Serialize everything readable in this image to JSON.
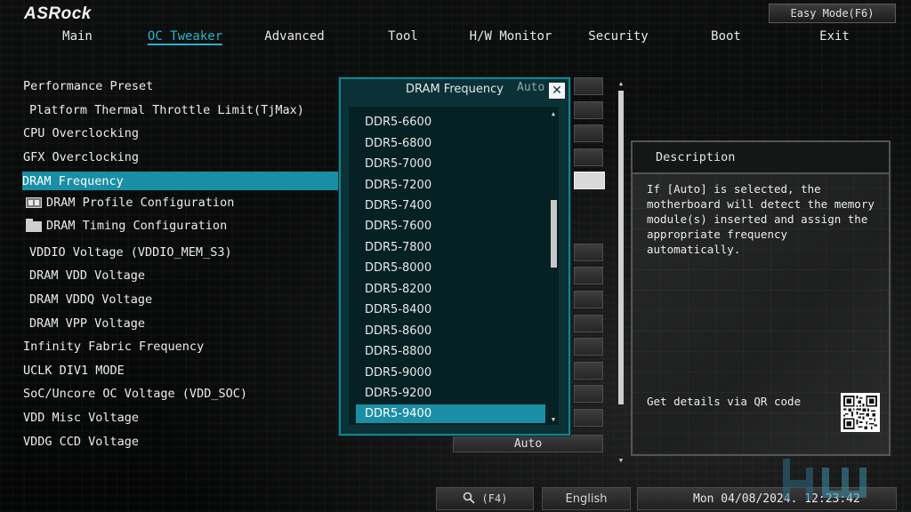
{
  "brand": {
    "logo": "ASRock"
  },
  "header": {
    "easy_mode_label": "Easy Mode(F6)",
    "tabs": [
      {
        "label": "Main",
        "active": false
      },
      {
        "label": "OC Tweaker",
        "active": true
      },
      {
        "label": "Advanced",
        "active": false
      },
      {
        "label": "Tool",
        "active": false
      },
      {
        "label": "H/W Monitor",
        "active": false
      },
      {
        "label": "Security",
        "active": false
      },
      {
        "label": "Boot",
        "active": false
      },
      {
        "label": "Exit",
        "active": false
      }
    ]
  },
  "menu": {
    "items": [
      {
        "label": "Performance Preset"
      },
      {
        "label": "Platform Thermal Throttle Limit(TjMax)"
      },
      {
        "label": "CPU Overclocking"
      },
      {
        "label": "GFX Overclocking"
      },
      {
        "label": "DRAM Frequency",
        "selected": true
      },
      {
        "label": "DRAM Profile Configuration",
        "icon": "profile-icon"
      },
      {
        "label": "DRAM Timing Configuration",
        "icon": "folder-icon"
      },
      {
        "label": "VDDIO Voltage (VDDIO_MEM_S3)"
      },
      {
        "label": "DRAM VDD Voltage"
      },
      {
        "label": "DRAM VDDQ Voltage"
      },
      {
        "label": "DRAM VPP Voltage"
      },
      {
        "label": "Infinity Fabric Frequency"
      },
      {
        "label": "UCLK DIV1 MODE"
      },
      {
        "label": "SoC/Uncore OC Voltage (VDD_SOC)"
      },
      {
        "label": "VDD Misc Voltage"
      },
      {
        "label": "VDDG CCD Voltage"
      }
    ],
    "last_value": "Auto"
  },
  "popup": {
    "title": "DRAM Frequency",
    "current_value": "Auto",
    "close_icon": "close-icon",
    "options": [
      "DDR5-6600",
      "DDR5-6800",
      "DDR5-7000",
      "DDR5-7200",
      "DDR5-7400",
      "DDR5-7600",
      "DDR5-7800",
      "DDR5-8000",
      "DDR5-8200",
      "DDR5-8400",
      "DDR5-8600",
      "DDR5-8800",
      "DDR5-9000",
      "DDR5-9200",
      "DDR5-9400"
    ],
    "selected_option": "DDR5-9400"
  },
  "description": {
    "header": "Description",
    "lines": [
      "If [Auto] is selected, the",
      "motherboard will detect the memory",
      "module(s) inserted and assign the",
      "appropriate frequency automatically."
    ],
    "qr_label": "Get details via QR code"
  },
  "footer": {
    "search_icon": "search-icon",
    "search_key": "(F4)",
    "language": "English",
    "datetime": "Mon 04/08/2024. 12:23:42"
  },
  "colors": {
    "accent": "#1a8ea4",
    "active_tab": "#29b3cc",
    "popup_border": "#16828f",
    "popup_bg": "#0a3236"
  }
}
